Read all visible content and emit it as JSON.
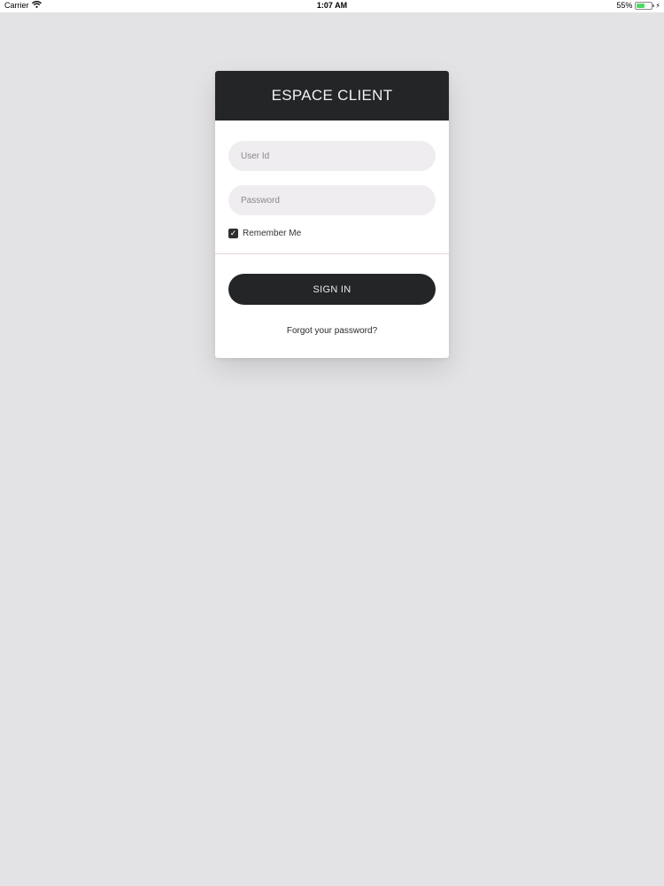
{
  "status_bar": {
    "carrier": "Carrier",
    "time": "1:07 AM",
    "battery_percent": "55%",
    "battery_level": 0.55,
    "icons": [
      "wifi-icon",
      "battery-icon",
      "charging-bolt-icon"
    ]
  },
  "login": {
    "title": "ESPACE CLIENT",
    "user_placeholder": "User Id",
    "user_value": "",
    "password_placeholder": "Password",
    "password_value": "",
    "remember_label": "Remember Me",
    "remember_checked": true,
    "signin_label": "SIGN IN",
    "forgot_label": "Forgot your password?"
  },
  "colors": {
    "background": "#e3e2e4",
    "header": "#232526",
    "button": "#232526",
    "field": "#efedf0",
    "battery": "#4cd964"
  }
}
